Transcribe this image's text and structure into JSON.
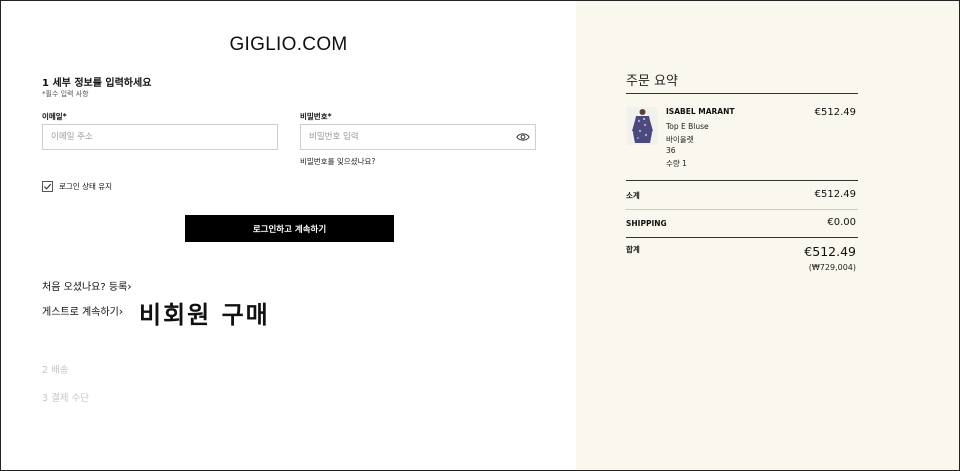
{
  "site": {
    "logo": "GIGLIO.COM"
  },
  "login": {
    "step_title": "1 세부 정보를 입력하세요",
    "required_note": "*필수 입력 사항",
    "email_label": "이메일*",
    "email_placeholder": "이메일 주소",
    "password_label": "비밀번호*",
    "password_placeholder": "비밀번호 입력",
    "forgot_password": "비밀번호를 잊으셨나요?",
    "remember_me": "로그인 상태 유지",
    "remember_checked": true,
    "submit_label": "로그인하고 계속하기",
    "register_link": "처음 오셨나요? 등록",
    "guest_link": "게스트로 계속하기",
    "nonmember_annotation": "비회원 구매"
  },
  "steps": {
    "step2": "2 배송",
    "step3": "3 결제 수단"
  },
  "summary": {
    "title": "주문 요약",
    "item": {
      "brand": "ISABEL MARANT",
      "name": "Top E Bluse",
      "color": "바이올렛",
      "size": "36",
      "quantity": "수량 1",
      "price": "€512.49"
    },
    "subtotal_label": "소계",
    "subtotal_value": "€512.49",
    "shipping_label": "SHIPPING",
    "shipping_value": "€0.00",
    "total_label": "합계",
    "total_value": "€512.49",
    "total_krw": "(₩729,004)"
  },
  "colors": {
    "summary_bg": "#faf7ef",
    "button_bg": "#000000",
    "muted_step": "#c4c4c4"
  }
}
